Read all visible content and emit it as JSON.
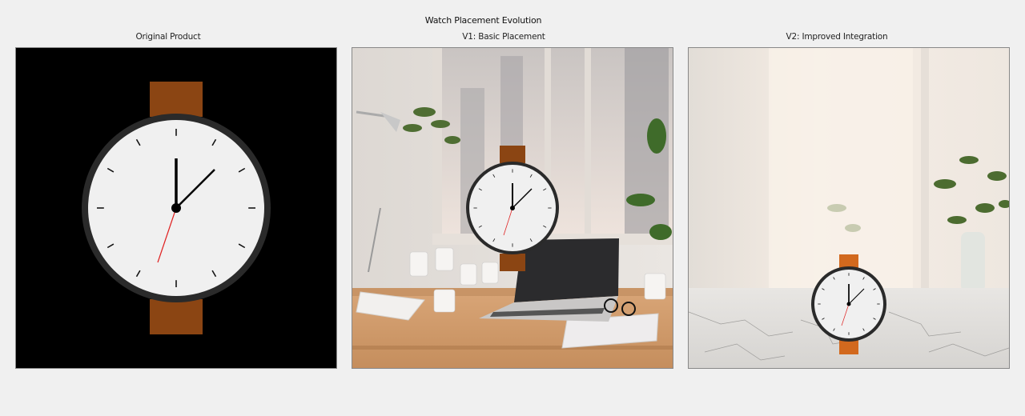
{
  "figure": {
    "title": "Watch Placement Evolution"
  },
  "panels": [
    {
      "title": "Original Product"
    },
    {
      "title": "V1: Basic Placement"
    },
    {
      "title": "V2: Improved Integration"
    }
  ],
  "colors": {
    "background": "#f0f0f0",
    "strap_original": "#8b4513",
    "strap_v1": "#8b4513",
    "strap_v2": "#d2691e",
    "watch_face": "#f0f0f0",
    "watch_bezel": "#2a2a2a",
    "second_hand": "#e02020"
  },
  "watch_time": {
    "hour": 1,
    "minute": 8,
    "second": 35
  }
}
